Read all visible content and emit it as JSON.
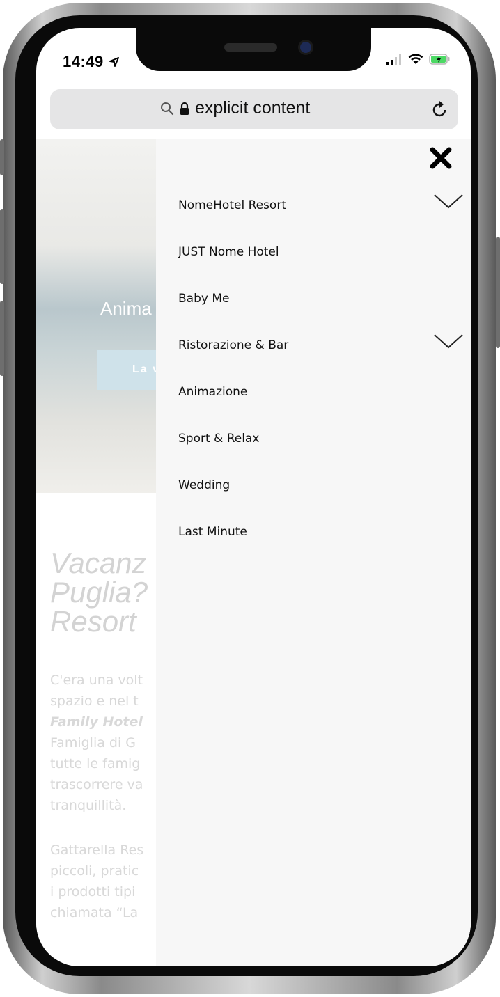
{
  "status_bar": {
    "time": "14:49"
  },
  "browser": {
    "address_text": "explicit content"
  },
  "hero": {
    "caption": "Anima",
    "button_label": "La v"
  },
  "page": {
    "heading_lines": [
      "Vacanz",
      "Puglia?",
      "Resort"
    ],
    "paragraph1_lines": [
      "C'era una volt",
      "spazio e nel t",
      "Family Hotel",
      "Famiglia di G",
      "tutte le famig",
      "trascorrere va",
      "tranquillità."
    ],
    "paragraph2_lines": [
      "Gattarella Res",
      "piccoli, pratic",
      "i prodotti tipi",
      "chiamata “La"
    ]
  },
  "menu": {
    "items": [
      {
        "label": "NomeHotel Resort",
        "has_submenu": true
      },
      {
        "label": "JUST Nome Hotel",
        "has_submenu": false
      },
      {
        "label": "Baby Me",
        "has_submenu": false
      },
      {
        "label": "Ristorazione & Bar",
        "has_submenu": true
      },
      {
        "label": "Animazione",
        "has_submenu": false
      },
      {
        "label": "Sport & Relax",
        "has_submenu": false
      },
      {
        "label": "Wedding",
        "has_submenu": false
      },
      {
        "label": "Last Minute",
        "has_submenu": false
      }
    ]
  },
  "icons": {
    "close": "close-icon",
    "chevron": "chevron-down-icon",
    "search": "search-icon",
    "lock": "lock-icon",
    "reload": "reload-icon",
    "signal": "signal-icon",
    "wifi": "wifi-icon",
    "battery": "battery-icon",
    "location": "location-arrow-icon"
  },
  "colors": {
    "menu_background": "#f7f7f7",
    "battery_green": "#4cd964",
    "hero_button": "#cfe2ea"
  }
}
